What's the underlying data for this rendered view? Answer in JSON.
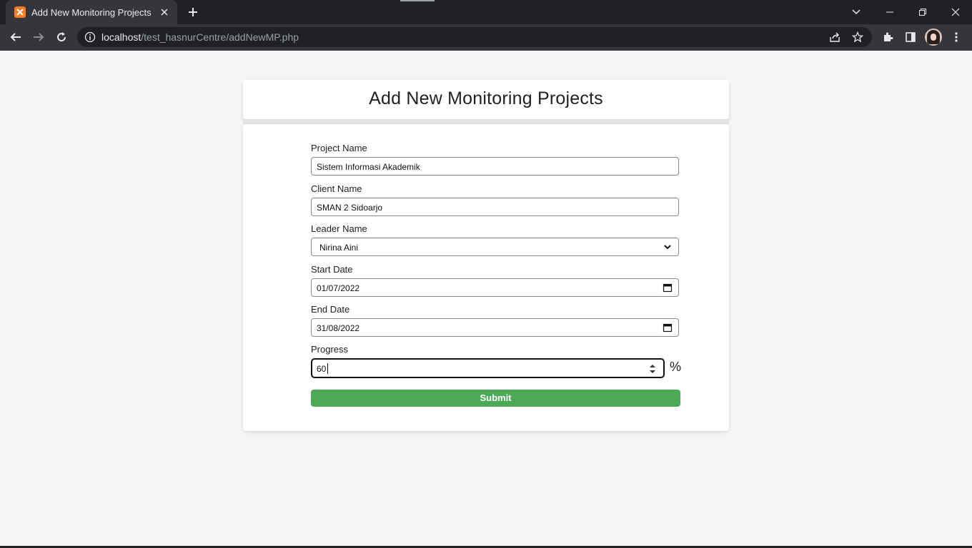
{
  "browser": {
    "tab_title": "Add New Monitoring Projects",
    "url_host": "localhost",
    "url_path": "/test_hasnurCentre/addNewMP.php"
  },
  "page": {
    "heading": "Add New Monitoring Projects"
  },
  "form": {
    "project_name_label": "Project Name",
    "project_name_value": "Sistem Informasi Akademik",
    "client_name_label": "Client Name",
    "client_name_value": "SMAN 2 Sidoarjo",
    "leader_name_label": "Leader Name",
    "leader_name_value": "Nirina Aini",
    "start_date_label": "Start Date",
    "start_date_value": "01/07/2022",
    "end_date_label": "End Date",
    "end_date_value": "31/08/2022",
    "progress_label": "Progress",
    "progress_value": "60",
    "progress_unit": "%",
    "submit_label": "Submit"
  },
  "colors": {
    "submit_green": "#4caa57",
    "chrome_dark": "#202124",
    "favicon_orange": "#fb7a24"
  },
  "icons": [
    "xampp-favicon",
    "close-icon",
    "plus-icon",
    "back-icon",
    "forward-icon",
    "reload-icon",
    "info-icon",
    "share-icon",
    "star-icon",
    "extensions-icon",
    "side-panel-icon",
    "avatar",
    "menu-icon",
    "calendar-icon",
    "chevron-down-icon",
    "spinner-icon"
  ]
}
